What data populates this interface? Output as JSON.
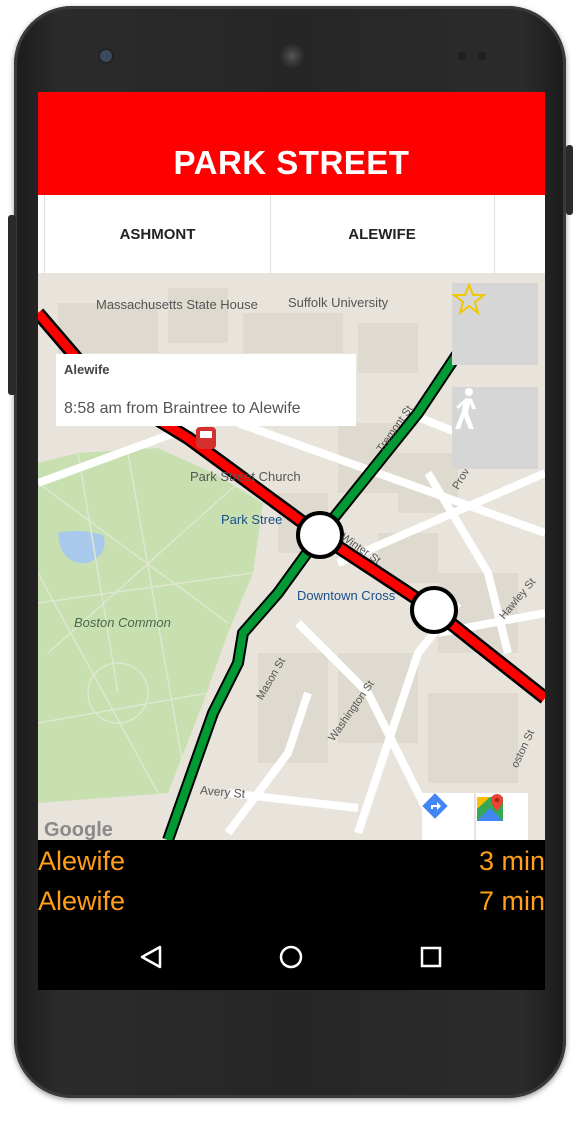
{
  "header": {
    "title": "PARK STREET"
  },
  "tabs": [
    {
      "label": "ASHMONT",
      "selected": false
    },
    {
      "label": "ALEWIFE",
      "selected": true
    }
  ],
  "map": {
    "labels": {
      "state_house": "Massachusetts State House",
      "suffolk": "Suffolk University",
      "park_street_church": "Park Street Church",
      "park_street": "Park Stree",
      "downtown_crossing": "Downtown Cross",
      "boston_common": "Boston Common",
      "tremont": "Tremont St",
      "winter": "Winter St",
      "province": "Prov",
      "hawley": "Hawley St",
      "mason": "Mason St",
      "washington": "Washington St",
      "avery": "Avery St",
      "boston_st": "oston St",
      "google": "Google"
    },
    "info_window": {
      "title": "Alewife",
      "subtitle": "8:58 am from Braintree to Alewife"
    },
    "icons": {
      "favorite": "star-icon",
      "walk": "walking-person-icon",
      "directions": "directions-icon",
      "maps": "google-maps-icon",
      "train": "train-icon"
    },
    "colors": {
      "red_line": "#ff0000",
      "green_line": "#009933"
    }
  },
  "arrivals": [
    {
      "destination": "Alewife",
      "time": "3 min"
    },
    {
      "destination": "Alewife",
      "time": "7 min"
    }
  ],
  "navbar": {
    "back": "back-icon",
    "home": "home-icon",
    "recents": "recents-icon"
  },
  "theme": {
    "accent": "#ff0000",
    "arrival_text": "#ff9f1a"
  }
}
